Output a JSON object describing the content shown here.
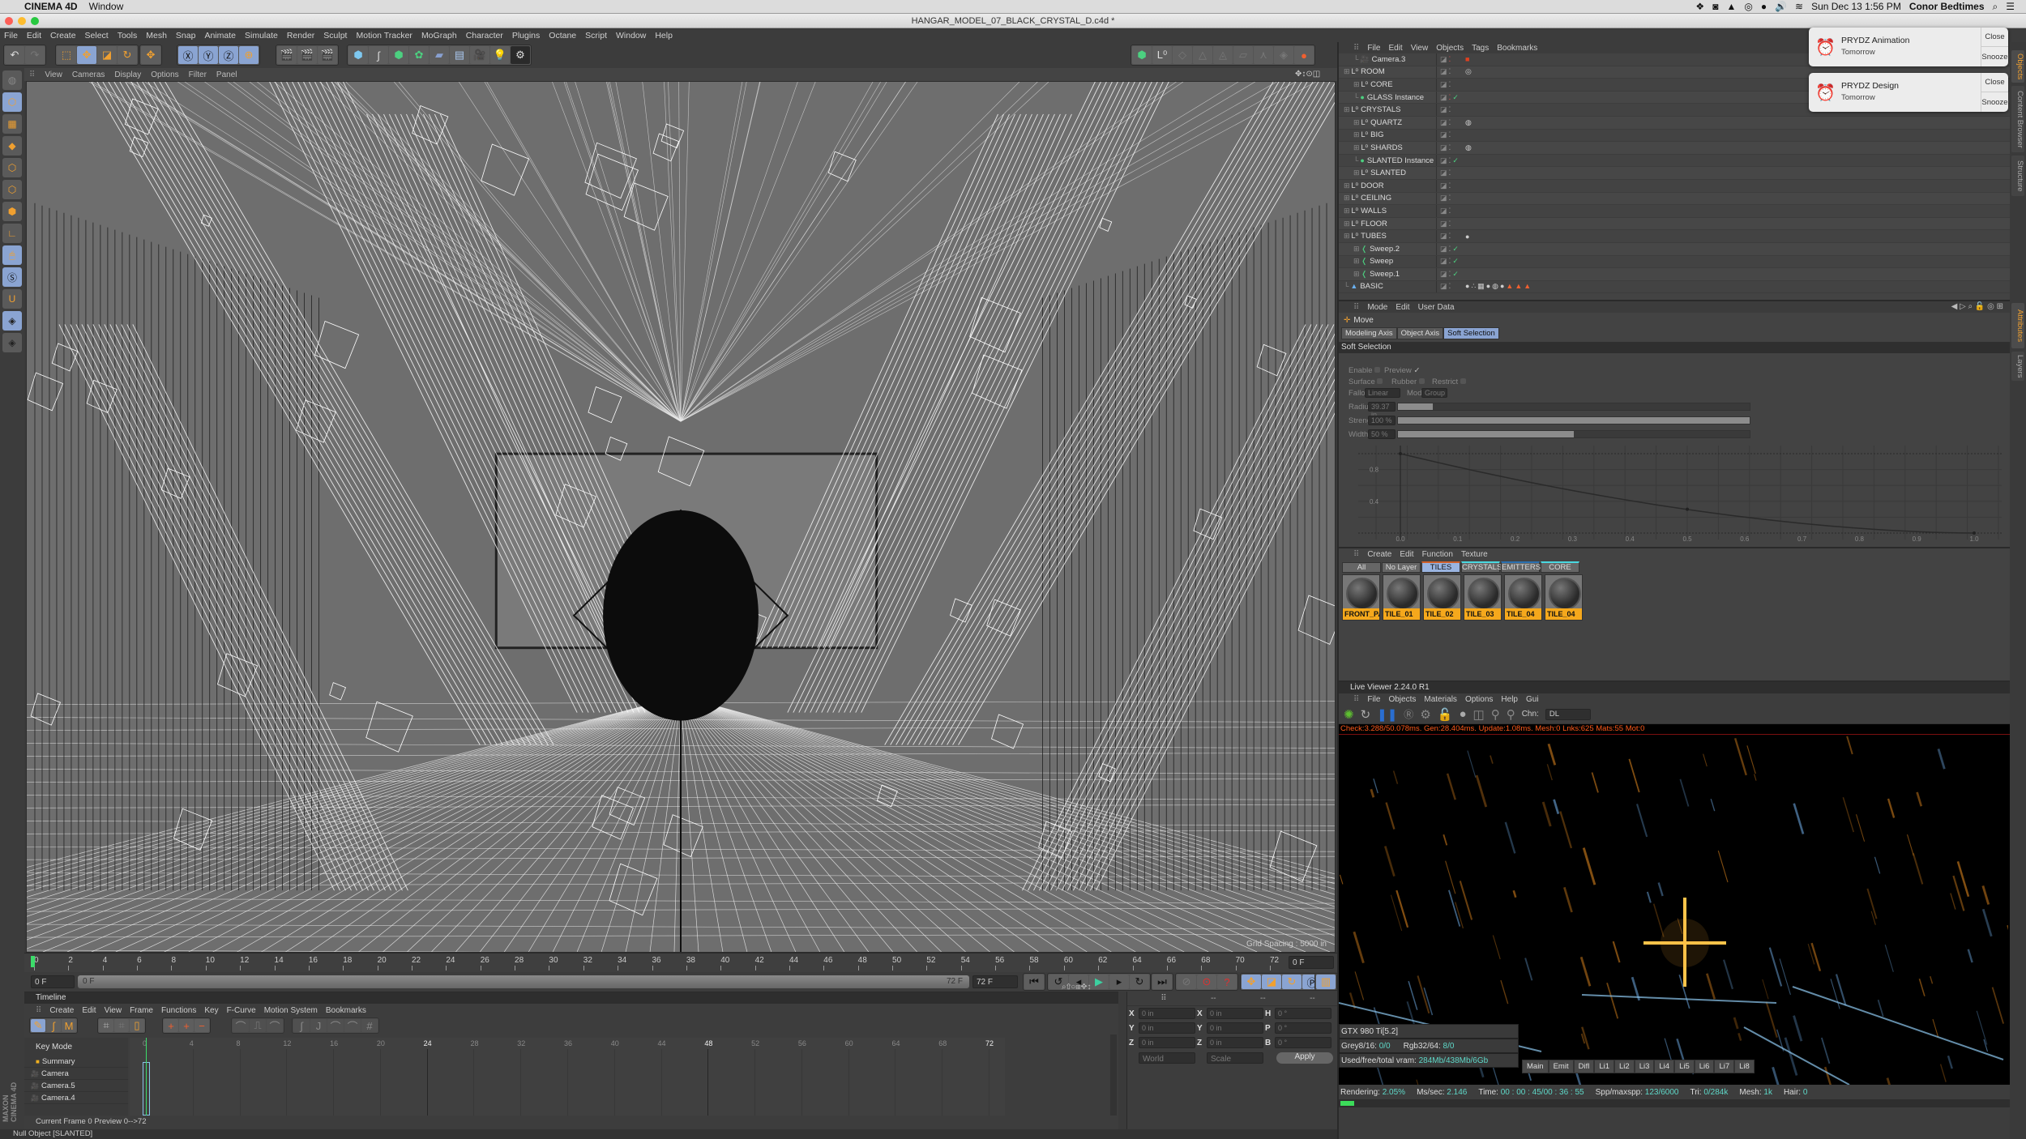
{
  "mac_menubar": {
    "app_name": "CINEMA 4D",
    "menus": [
      "Window"
    ],
    "status_icons": [
      "dropbox-icon",
      "nvidia-icon",
      "drive-icon",
      "creative-cloud-icon",
      "evernote-icon",
      "volume-icon",
      "wifi-icon"
    ],
    "datetime": "Sun Dec 13  1:56 PM",
    "user": "Conor Bedtimes"
  },
  "window": {
    "title": "HANGAR_MODEL_07_BLACK_CRYSTAL_D.c4d *"
  },
  "app_menu": [
    "File",
    "Edit",
    "Create",
    "Select",
    "Tools",
    "Mesh",
    "Snap",
    "Animate",
    "Simulate",
    "Render",
    "Sculpt",
    "Motion Tracker",
    "MoGraph",
    "Character",
    "Plugins",
    "Octane",
    "Script",
    "Window",
    "Help"
  ],
  "viewport": {
    "menu": [
      "View",
      "Cameras",
      "Display",
      "Options",
      "Filter",
      "Panel"
    ],
    "grid_spacing": "Grid Spacing : 5000 in"
  },
  "notifications": [
    {
      "title": "PRYDZ Animation",
      "subtitle": "Tomorrow",
      "close": "Close",
      "snooze": "Snooze"
    },
    {
      "title": "PRYDZ Design",
      "subtitle": "Tomorrow",
      "close": "Close",
      "snooze": "Snooze"
    }
  ],
  "side_tabs": {
    "top": [
      "Objects",
      "Content Browser",
      "Structure"
    ],
    "bottom": [
      "Attributes",
      "Layers"
    ]
  },
  "object_manager": {
    "menu": [
      "File",
      "Edit",
      "View",
      "Objects",
      "Tags",
      "Bookmarks"
    ],
    "objects": [
      {
        "name": "Camera.3",
        "indent": 1,
        "icon": "camera",
        "check": false
      },
      {
        "name": "ROOM",
        "indent": 0,
        "icon": "null",
        "check": false
      },
      {
        "name": "CORE",
        "indent": 1,
        "icon": "null",
        "check": false
      },
      {
        "name": "GLASS Instance",
        "indent": 1,
        "icon": "instance",
        "check": true
      },
      {
        "name": "CRYSTALS",
        "indent": 0,
        "icon": "null",
        "check": false
      },
      {
        "name": "QUARTZ",
        "indent": 1,
        "icon": "null",
        "check": false
      },
      {
        "name": "BIG",
        "indent": 1,
        "icon": "null",
        "check": false
      },
      {
        "name": "SHARDS",
        "indent": 1,
        "icon": "null",
        "check": false
      },
      {
        "name": "SLANTED Instance",
        "indent": 1,
        "icon": "instance",
        "check": true
      },
      {
        "name": "SLANTED",
        "indent": 1,
        "icon": "null",
        "check": false
      },
      {
        "name": "DOOR",
        "indent": 0,
        "icon": "null",
        "check": false
      },
      {
        "name": "CEILING",
        "indent": 0,
        "icon": "null",
        "check": false
      },
      {
        "name": "WALLS",
        "indent": 0,
        "icon": "null",
        "check": false
      },
      {
        "name": "FLOOR",
        "indent": 0,
        "icon": "null",
        "check": false
      },
      {
        "name": "TUBES",
        "indent": 0,
        "icon": "null",
        "check": false
      },
      {
        "name": "Sweep.2",
        "indent": 1,
        "icon": "sweep",
        "check": true
      },
      {
        "name": "Sweep",
        "indent": 1,
        "icon": "sweep",
        "check": true
      },
      {
        "name": "Sweep.1",
        "indent": 1,
        "icon": "sweep",
        "check": true
      },
      {
        "name": "BASIC",
        "indent": 0,
        "icon": "light",
        "check": false
      }
    ]
  },
  "attributes": {
    "menu": [
      "Mode",
      "Edit",
      "User Data"
    ],
    "tool": "Move",
    "tabs": [
      "Modeling Axis",
      "Object Axis",
      "Soft Selection"
    ],
    "active_tab": "Soft Selection",
    "section": "Soft Selection",
    "enable_label": "Enable",
    "enable": false,
    "preview_label": "Preview",
    "preview": true,
    "surface_label": "Surface",
    "rubber_label": "Rubber",
    "restrict_label": "Restrict",
    "falloff_label": "Falloff",
    "falloff": "Linear",
    "mode_label": "Mode",
    "mode": "Group",
    "radius_label": "Radius",
    "radius": "39.37 in",
    "radius_fraction": 0.1,
    "strength_label": "Strength",
    "strength": "100 %",
    "strength_fraction": 1.0,
    "width_label": "Width ..",
    "width": "50 %",
    "width_fraction": 0.5,
    "curve": {
      "x_ticks": [
        "0.0",
        "0.1",
        "0.2",
        "0.3",
        "0.4",
        "0.5",
        "0.6",
        "0.7",
        "0.8",
        "0.9",
        "1.0"
      ],
      "y_ticks": [
        "0.8",
        "0.4"
      ],
      "points": [
        [
          0,
          1
        ],
        [
          0.5,
          0.3
        ],
        [
          1,
          0
        ]
      ]
    }
  },
  "material_manager": {
    "menu": [
      "Create",
      "Edit",
      "Function",
      "Texture"
    ],
    "tabs": [
      "All",
      "No Layer",
      "TILES",
      "CRYSTALS",
      "EMITTERS",
      "CORE"
    ],
    "active_tab": "TILES",
    "materials": [
      "FRONT_PA",
      "TILE_01",
      "TILE_02",
      "TILE_03",
      "TILE_04",
      "TILE_04"
    ]
  },
  "live_viewer": {
    "title": "Live Viewer 2.24.0 R1",
    "menu": [
      "File",
      "Objects",
      "Materials",
      "Options",
      "Help",
      "Gui"
    ],
    "channel_label": "Chn:",
    "channel": "DL",
    "stats_line": "Check:3.288/50.078ms. Gen:28.404ms. Update:1.08ms. Mesh:0 Lnks:625 Mats:55 Mot:0",
    "gpu": "GTX 980 Ti[5.2]",
    "grey_label": "Grey8/16:",
    "grey": "0/0",
    "rgb_label": "Rgb32/64:",
    "rgb": "8/0",
    "vram_label": "Used/free/total vram:",
    "vram": "284Mb/438Mb/6Gb",
    "passes": [
      "Main",
      "Emit",
      "Difl",
      "Li1",
      "Li2",
      "Li3",
      "Li4",
      "Li5",
      "Li6",
      "Li7",
      "Li8"
    ],
    "rendering_label": "Rendering:",
    "rendering": "2.05%",
    "mssec_label": "Ms/sec:",
    "mssec": "2.146",
    "time_label": "Time:",
    "time": "00 : 00 : 45/00 : 36 : 55",
    "spp_label": "Spp/maxspp:",
    "spp": "123/6000",
    "tri_label": "Tri:",
    "tri": "0/284k",
    "mesh_label": "Mesh:",
    "mesh": "1k",
    "hair_label": "Hair:",
    "hair": "0",
    "progress": 0.0205
  },
  "timeline_ruler": {
    "ticks": [
      "0",
      "2",
      "4",
      "6",
      "8",
      "10",
      "12",
      "14",
      "16",
      "18",
      "20",
      "22",
      "24",
      "26",
      "28",
      "30",
      "32",
      "34",
      "36",
      "38",
      "40",
      "42",
      "44",
      "46",
      "48",
      "50",
      "52",
      "54",
      "56",
      "58",
      "60",
      "62",
      "64",
      "66",
      "68",
      "70",
      "72"
    ],
    "current_frame_field": "0 F",
    "start_field": "0 F",
    "slider_start": "0 F",
    "slider_end": "72 F",
    "end_field": "72 F"
  },
  "timeline": {
    "title": "Timeline",
    "menu": [
      "Create",
      "Edit",
      "View",
      "Frame",
      "Functions",
      "Key",
      "F-Curve",
      "Motion System",
      "Bookmarks"
    ],
    "key_mode": "Key Mode",
    "ticks": [
      "0",
      "4",
      "8",
      "12",
      "16",
      "20",
      "24",
      "28",
      "32",
      "36",
      "40",
      "44",
      "48",
      "52",
      "56",
      "60",
      "64",
      "68",
      "72"
    ],
    "tracks": [
      "Summary",
      "Camera",
      "Camera.5",
      "Camera.4"
    ],
    "footer": "Current Frame  0  Preview  0-->72"
  },
  "coordinates": {
    "headers": [
      "--",
      "--",
      "--"
    ],
    "rows": [
      {
        "a": "X",
        "av": "0 in",
        "b": "X",
        "bv": "0 in",
        "c": "H",
        "cv": "0 °"
      },
      {
        "a": "Y",
        "av": "0 in",
        "b": "Y",
        "bv": "0 in",
        "c": "P",
        "cv": "0 °"
      },
      {
        "a": "Z",
        "av": "0 in",
        "b": "Z",
        "bv": "0 in",
        "c": "B",
        "cv": "0 °"
      }
    ],
    "space": "World",
    "mode": "Scale",
    "apply": "Apply"
  },
  "status_bar": "Null Object [SLANTED]",
  "branding": "MAXON CINEMA 4D"
}
